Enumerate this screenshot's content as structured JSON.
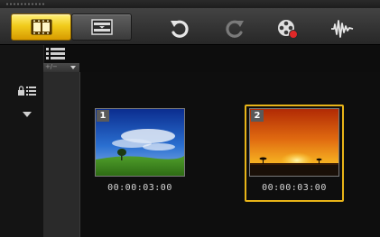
{
  "toolbar": {
    "tabs": [
      {
        "name": "storyboard-view",
        "icon": "film-strip-icon",
        "active": true
      },
      {
        "name": "timeline-view",
        "icon": "timeline-icon",
        "active": false
      }
    ],
    "actions": [
      {
        "name": "undo",
        "icon": "undo-icon",
        "enabled": true
      },
      {
        "name": "redo",
        "icon": "redo-icon",
        "enabled": false
      },
      {
        "name": "record-capture",
        "icon": "record-capture-icon",
        "enabled": true
      },
      {
        "name": "sound-mixer",
        "icon": "audio-waveform-icon",
        "enabled": true
      }
    ],
    "accent_color": "#f1cb1c"
  },
  "sidebar": {
    "icons": [
      "list-view-icon",
      "lock-tracks-icon",
      "expand-arrow-icon"
    ],
    "add_remove_label": "+/−"
  },
  "clips": [
    {
      "number": "1",
      "timecode": "00:00:03:00",
      "scene": "blue-sky-field-tree",
      "selected": false
    },
    {
      "number": "2",
      "timecode": "00:00:03:00",
      "scene": "orange-sunset-horizon",
      "selected": true
    }
  ],
  "colors": {
    "selection_border": "#e8b418",
    "background": "#0d0d0d"
  }
}
